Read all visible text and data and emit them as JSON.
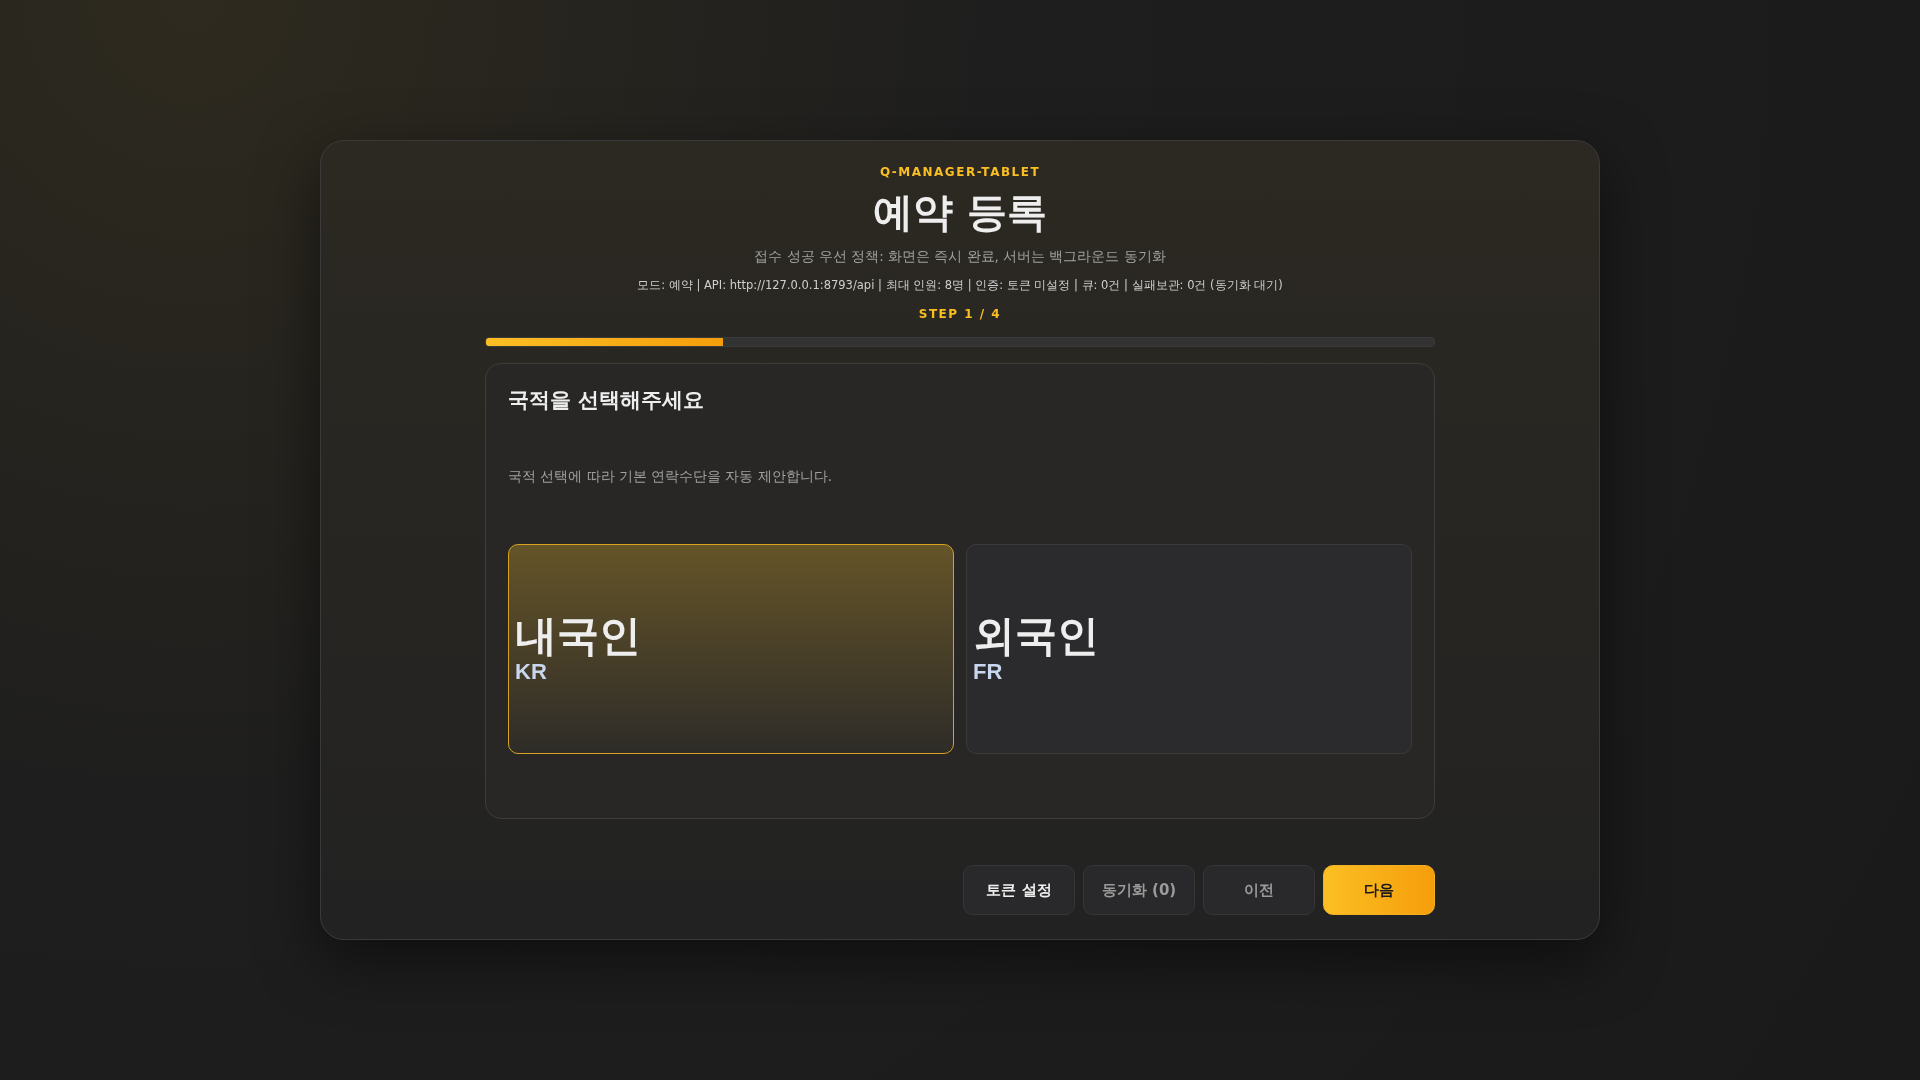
{
  "brand": "Q-MANAGER-TABLET",
  "title": "예약 등록",
  "subtitle": "접수 성공 우선 정책: 화면은 즉시 완료, 서버는 백그라운드 동기화",
  "status_line": "모드: 예약 | API: http://127.0.0.1:8793/api | 최대 인원: 8명 | 인증: 토큰 미설정 | 큐: 0건 | 실패보관: 0건 (동기화 대기)",
  "step": {
    "label": "STEP 1 / 4",
    "level": 0.25
  },
  "panel": {
    "title": "국적을 선택해주세요",
    "description": "국적 선택에 따라 기본 연락수단을 자동 제안합니다.",
    "options": [
      {
        "label": "내국인",
        "code": "KR",
        "selected": true
      },
      {
        "label": "외국인",
        "code": "FR",
        "selected": false
      }
    ]
  },
  "buttons": [
    {
      "label": "토큰 설정",
      "kind": "secondary",
      "disabled": false
    },
    {
      "label": "동기화 (0)",
      "kind": "secondary",
      "disabled": true
    },
    {
      "label": "이전",
      "kind": "secondary",
      "disabled": true
    },
    {
      "label": "다음",
      "kind": "primary",
      "disabled": false
    }
  ]
}
